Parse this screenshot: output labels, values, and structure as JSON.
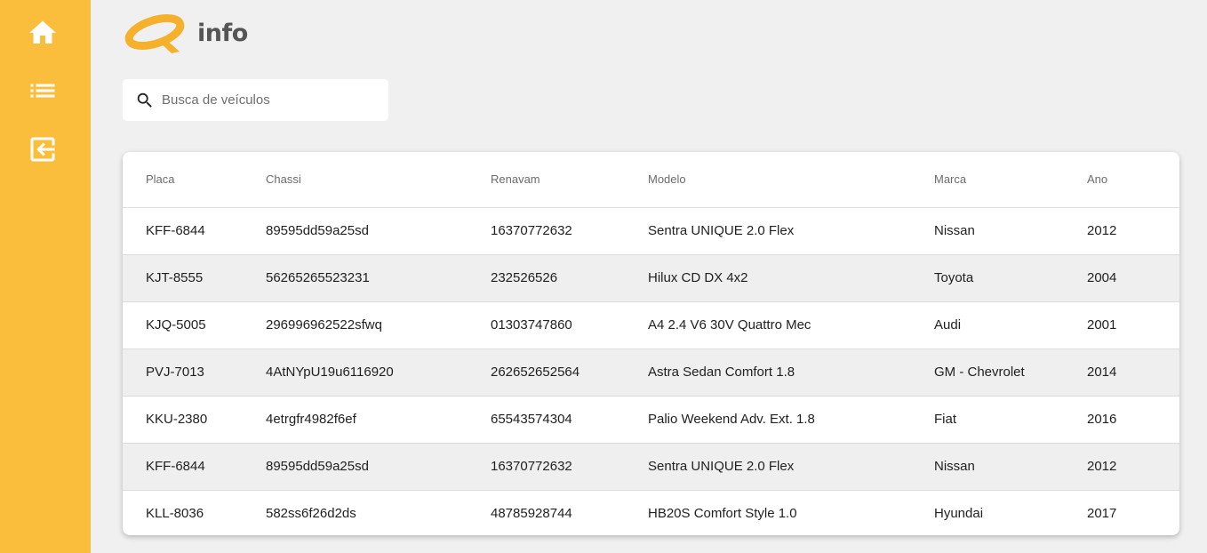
{
  "theme": {
    "sidebar_color": "#fbbe3c",
    "accent": "#f5b12c",
    "logo_text_color": "#555555"
  },
  "sidebar": {
    "items": [
      {
        "icon": "home-icon"
      },
      {
        "icon": "list-icon"
      },
      {
        "icon": "logout-icon"
      }
    ]
  },
  "logo": {
    "text": "info"
  },
  "search": {
    "placeholder": "Busca de veículos",
    "value": ""
  },
  "table": {
    "headers": [
      "Placa",
      "Chassi",
      "Renavam",
      "Modelo",
      "Marca",
      "Ano"
    ],
    "rows": [
      [
        "KFF-6844",
        "89595dd59a25sd",
        "16370772632",
        "Sentra UNIQUE 2.0 Flex",
        "Nissan",
        "2012"
      ],
      [
        "KJT-8555",
        "56265265523231",
        "232526526",
        "Hilux CD DX 4x2",
        "Toyota",
        "2004"
      ],
      [
        "KJQ-5005",
        "296996962522sfwq",
        "01303747860",
        "A4 2.4 V6 30V Quattro Mec",
        "Audi",
        "2001"
      ],
      [
        "PVJ-7013",
        "4AtNYpU19u6116920",
        "262652652564",
        "Astra Sedan Comfort 1.8",
        "GM - Chevrolet",
        "2014"
      ],
      [
        "KKU-2380",
        "4etrgfr4982f6ef",
        "65543574304",
        "Palio Weekend Adv. Ext. 1.8",
        "Fiat",
        "2016"
      ],
      [
        "KFF-6844",
        "89595dd59a25sd",
        "16370772632",
        "Sentra UNIQUE 2.0 Flex",
        "Nissan",
        "2012"
      ],
      [
        "KLL-8036",
        "582ss6f26d2ds",
        "48785928744",
        "HB20S Comfort Style 1.0",
        "Hyundai",
        "2017"
      ]
    ]
  }
}
